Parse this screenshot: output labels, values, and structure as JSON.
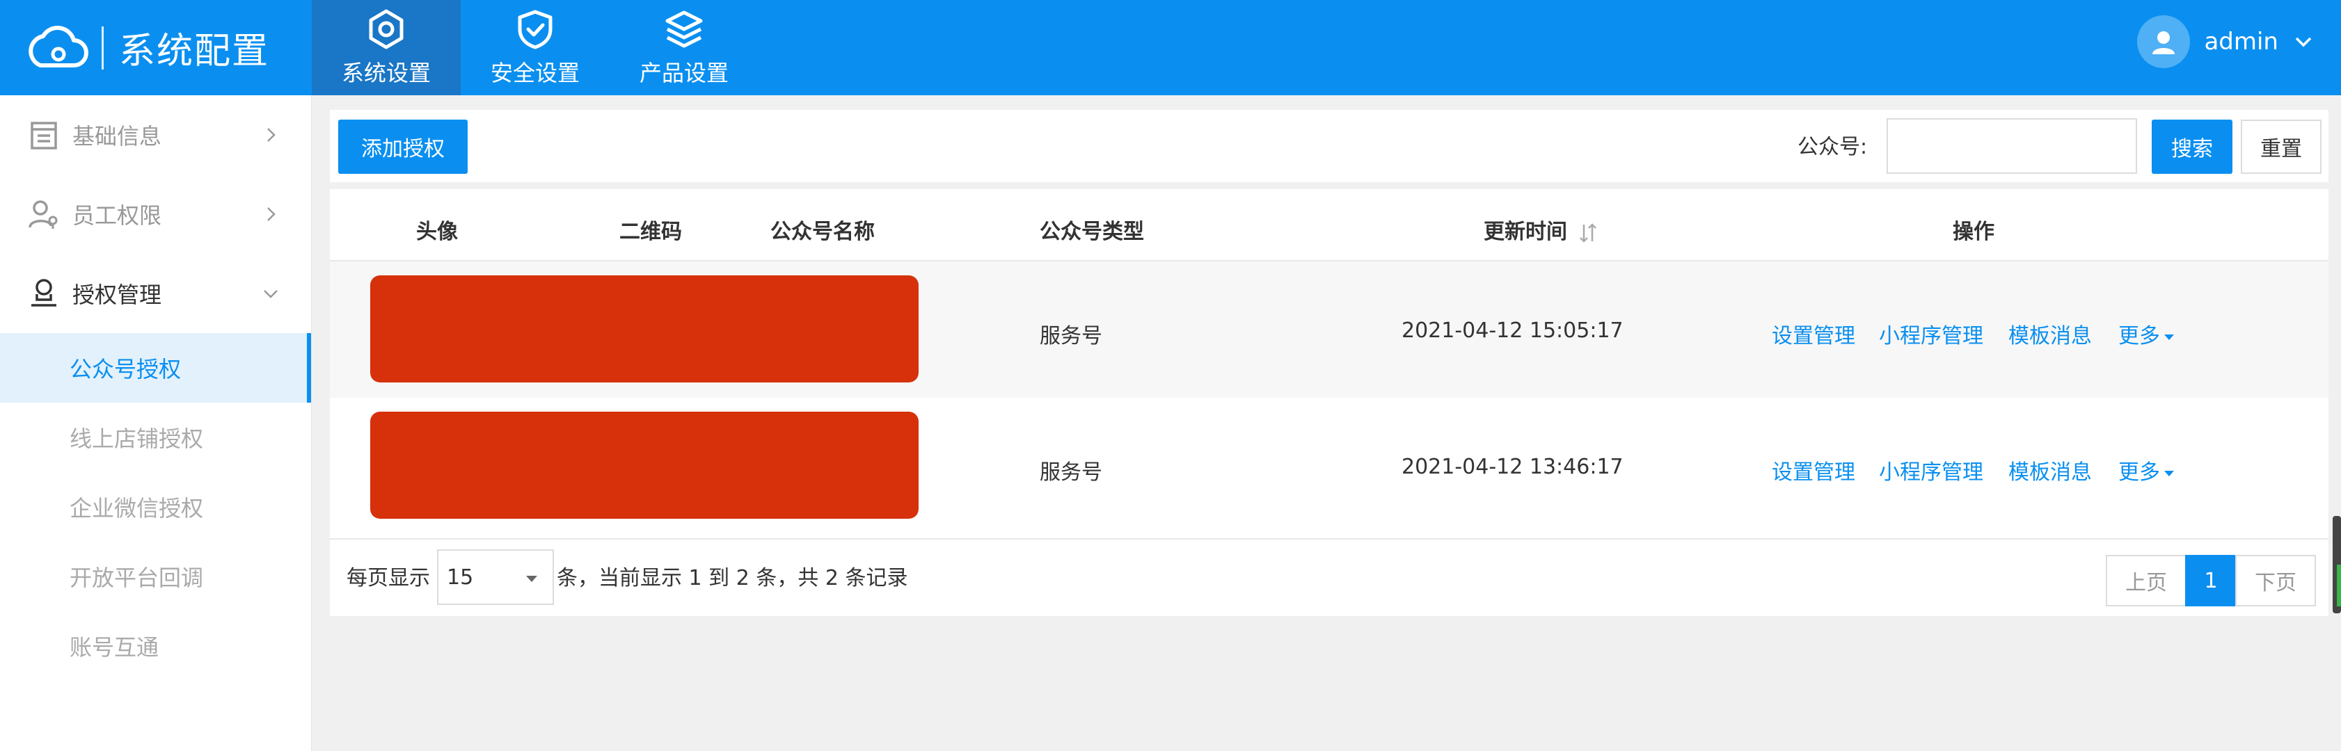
{
  "header": {
    "title": "系统配置",
    "nav": [
      {
        "label": "系统设置",
        "icon": "gear-icon"
      },
      {
        "label": "安全设置",
        "icon": "shield-check-icon"
      },
      {
        "label": "产品设置",
        "icon": "layers-icon"
      }
    ],
    "user": "admin"
  },
  "sidebar": {
    "items": [
      {
        "label": "基础信息",
        "icon": "document-icon"
      },
      {
        "label": "员工权限",
        "icon": "user-key-icon"
      },
      {
        "label": "授权管理",
        "icon": "user-stamp-icon"
      }
    ],
    "sub_items": [
      "公众号授权",
      "线上店铺授权",
      "企业微信授权",
      "开放平台回调",
      "账号互通"
    ]
  },
  "toolbar": {
    "add_label": "添加授权",
    "search_label": "公众号:",
    "search_value": "",
    "search_button": "搜索",
    "reset_button": "重置"
  },
  "table": {
    "columns": [
      "头像",
      "二维码",
      "公众号名称",
      "公众号类型",
      "更新时间",
      "操作"
    ],
    "rows": [
      {
        "type": "服务号",
        "updated": "2021-04-12 15:05:17"
      },
      {
        "type": "服务号",
        "updated": "2021-04-12 13:46:17"
      }
    ],
    "actions": [
      "设置管理",
      "小程序管理",
      "模板消息",
      "更多"
    ]
  },
  "pagination": {
    "per_page_label": "每页显示",
    "per_page_value": "15",
    "summary": "条，当前显示 1 到 2 条，共 2 条记录",
    "prev": "上页",
    "current": "1",
    "next": "下页"
  },
  "colors": {
    "primary": "#0a8ff0",
    "redaction": "#d6310b"
  }
}
